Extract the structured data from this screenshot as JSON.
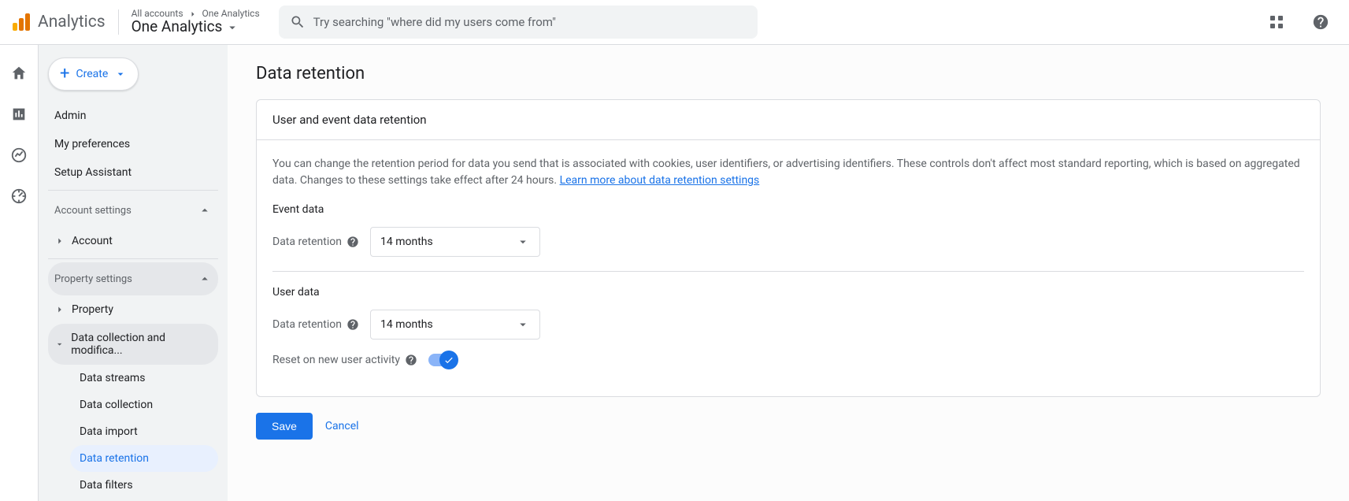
{
  "brand": {
    "name": "Analytics"
  },
  "breadcrumb": {
    "root": "All accounts",
    "property": "One Analytics",
    "title": "One Analytics"
  },
  "search": {
    "placeholder": "Try searching \"where did my users come from\""
  },
  "create_label": "Create",
  "side": {
    "admin": "Admin",
    "prefs": "My preferences",
    "setup": "Setup Assistant",
    "account_settings": "Account settings",
    "account": "Account",
    "property_settings": "Property settings",
    "property": "Property",
    "data_collection": "Data collection and modifica...",
    "sub": {
      "streams": "Data streams",
      "collection": "Data collection",
      "import": "Data import",
      "retention": "Data retention",
      "filters": "Data filters"
    }
  },
  "page": {
    "title": "Data retention",
    "card_title": "User and event data retention",
    "desc": "You can change the retention period for data you send that is associated with cookies, user identifiers, or advertising identifiers. These controls don't affect most standard reporting, which is based on aggregated data. Changes to these settings take effect after 24 hours. ",
    "learn_more": "Learn more about data retention settings",
    "event_data": "Event data",
    "user_data": "User data",
    "data_retention_label": "Data retention",
    "event_value": "14 months",
    "user_value": "14 months",
    "reset_label": "Reset on new user activity",
    "save": "Save",
    "cancel": "Cancel"
  }
}
